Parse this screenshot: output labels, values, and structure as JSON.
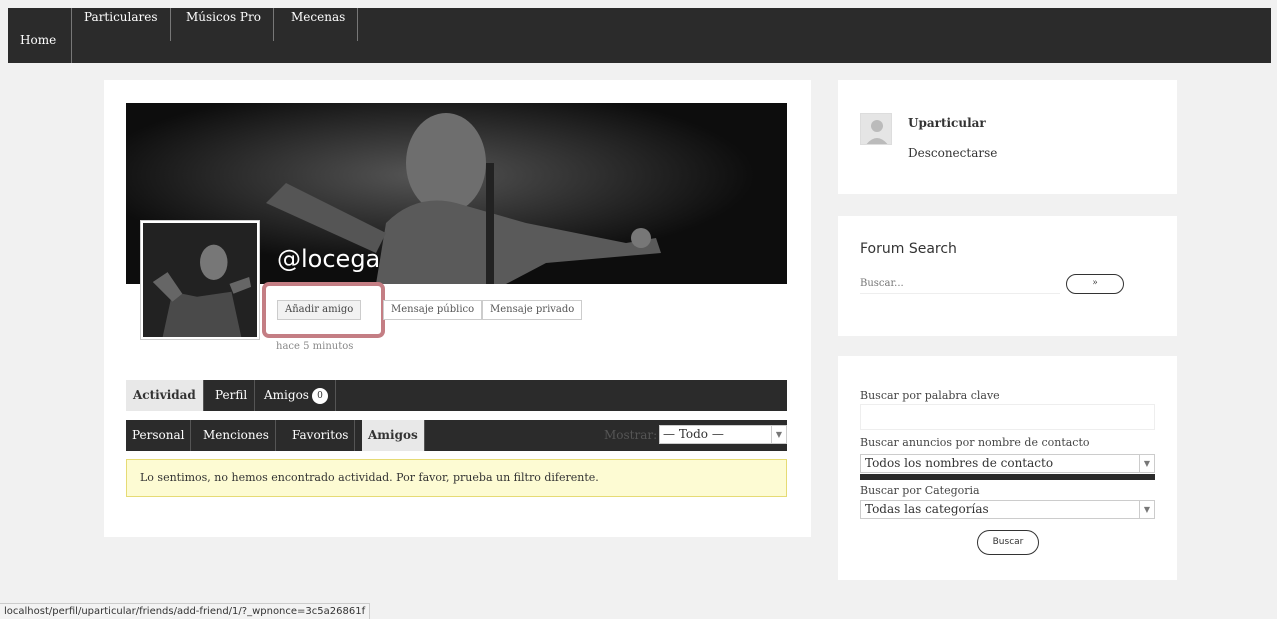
{
  "nav": {
    "home": "Home",
    "items": [
      "Particulares",
      "Músicos Pro",
      "Mecenas"
    ]
  },
  "profile": {
    "username": "@locega",
    "add_friend": "Añadir amigo",
    "public_message": "Mensaje público",
    "private_message": "Mensaje privado",
    "last_active": "hace 5 minutos",
    "tabs": [
      {
        "label": "Actividad"
      },
      {
        "label": "Perfil"
      },
      {
        "label": "Amigos",
        "count": "0"
      }
    ],
    "subtabs": [
      "Personal",
      "Menciones",
      "Favoritos",
      "Amigos"
    ],
    "filter_label": "Mostrar:",
    "filter_value": "— Todo —",
    "notice": "Lo sentimos, no hemos encontrado actividad. Por favor, prueba un filtro diferente."
  },
  "sidebar": {
    "user": {
      "name": "Uparticular",
      "logout": "Desconectarse"
    },
    "forum": {
      "title": "Forum Search",
      "placeholder": "Buscar...",
      "button": "»"
    },
    "search": {
      "keyword_label": "Buscar por palabra clave",
      "contact_label": "Buscar anuncios por nombre de contacto",
      "contact_value": "Todos los nombres de contacto",
      "category_label": "Buscar por Categoria",
      "category_value": "Todas las categorías",
      "button": "Buscar"
    }
  },
  "status_url": "localhost/perfil/uparticular/friends/add-friend/1/?_wpnonce=3c5a26861f",
  "colors": {
    "nav_bg": "#2b2b2b",
    "highlight": "#c47e84",
    "notice_bg": "#fdfbd3"
  }
}
